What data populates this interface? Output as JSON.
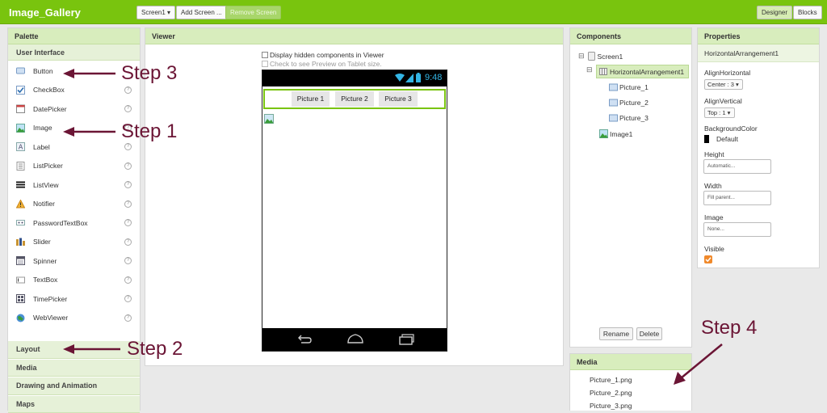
{
  "app": {
    "title": "Image_Gallery",
    "screen_select": "Screen1 ▾",
    "add_screen": "Add Screen ...",
    "remove_screen": "Remove Screen",
    "designer": "Designer",
    "blocks": "Blocks"
  },
  "palette": {
    "title": "Palette",
    "section": "User Interface",
    "items": [
      {
        "label": "Button",
        "icon": "button-icon"
      },
      {
        "label": "CheckBox",
        "icon": "checkbox-icon"
      },
      {
        "label": "DatePicker",
        "icon": "datepicker-icon"
      },
      {
        "label": "Image",
        "icon": "image-icon"
      },
      {
        "label": "Label",
        "icon": "label-icon"
      },
      {
        "label": "ListPicker",
        "icon": "listpicker-icon"
      },
      {
        "label": "ListView",
        "icon": "listview-icon"
      },
      {
        "label": "Notifier",
        "icon": "notifier-icon"
      },
      {
        "label": "PasswordTextBox",
        "icon": "password-icon"
      },
      {
        "label": "Slider",
        "icon": "slider-icon"
      },
      {
        "label": "Spinner",
        "icon": "spinner-icon"
      },
      {
        "label": "TextBox",
        "icon": "textbox-icon"
      },
      {
        "label": "TimePicker",
        "icon": "timepicker-icon"
      },
      {
        "label": "WebViewer",
        "icon": "webviewer-icon"
      }
    ],
    "help_glyph": "?",
    "categories": [
      "Layout",
      "Media",
      "Drawing and Animation",
      "Maps"
    ]
  },
  "viewer": {
    "title": "Viewer",
    "hidden_checkbox_label": "Display hidden components in Viewer",
    "tablet_checkbox_label": "Check to see Preview on Tablet size.",
    "time": "9:48",
    "buttons": [
      "Picture 1",
      "Picture 2",
      "Picture 3"
    ]
  },
  "components": {
    "title": "Components",
    "tree": {
      "screen": "Screen1",
      "arrangement": "HorizontalArrangement1",
      "pictures": [
        "Picture_1",
        "Picture_2",
        "Picture_3"
      ],
      "image": "Image1"
    },
    "rename": "Rename",
    "delete": "Delete",
    "collapse_glyph": "⊟"
  },
  "media": {
    "title": "Media",
    "files": [
      "Picture_1.png",
      "Picture_2.png",
      "Picture_3.png"
    ]
  },
  "properties": {
    "title": "Properties",
    "selected": "HorizontalArrangement1",
    "align_horizontal_label": "AlignHorizontal",
    "align_horizontal_value": "Center : 3 ▾",
    "align_vertical_label": "AlignVertical",
    "align_vertical_value": "Top : 1 ▾",
    "bgcolor_label": "BackgroundColor",
    "bgcolor_value": "Default",
    "height_label": "Height",
    "height_value": "Automatic...",
    "width_label": "Width",
    "width_value": "Fill parent...",
    "image_label": "Image",
    "image_value": "None...",
    "visible_label": "Visible",
    "visible_checked": true
  },
  "annotations": {
    "step1": "Step 1",
    "step2": "Step 2",
    "step3": "Step 3",
    "step4": "Step 4",
    "arrow_color": "#6b1535"
  },
  "colors": {
    "topbar": "#79c40e",
    "panel_header": "#d8edbd",
    "selected_row": "#d8edbd",
    "phone_frame": "#000000",
    "arrangement_border": "#79c40e",
    "status_accent": "#33b5e5",
    "visible_checkbox": "#f0892b"
  }
}
